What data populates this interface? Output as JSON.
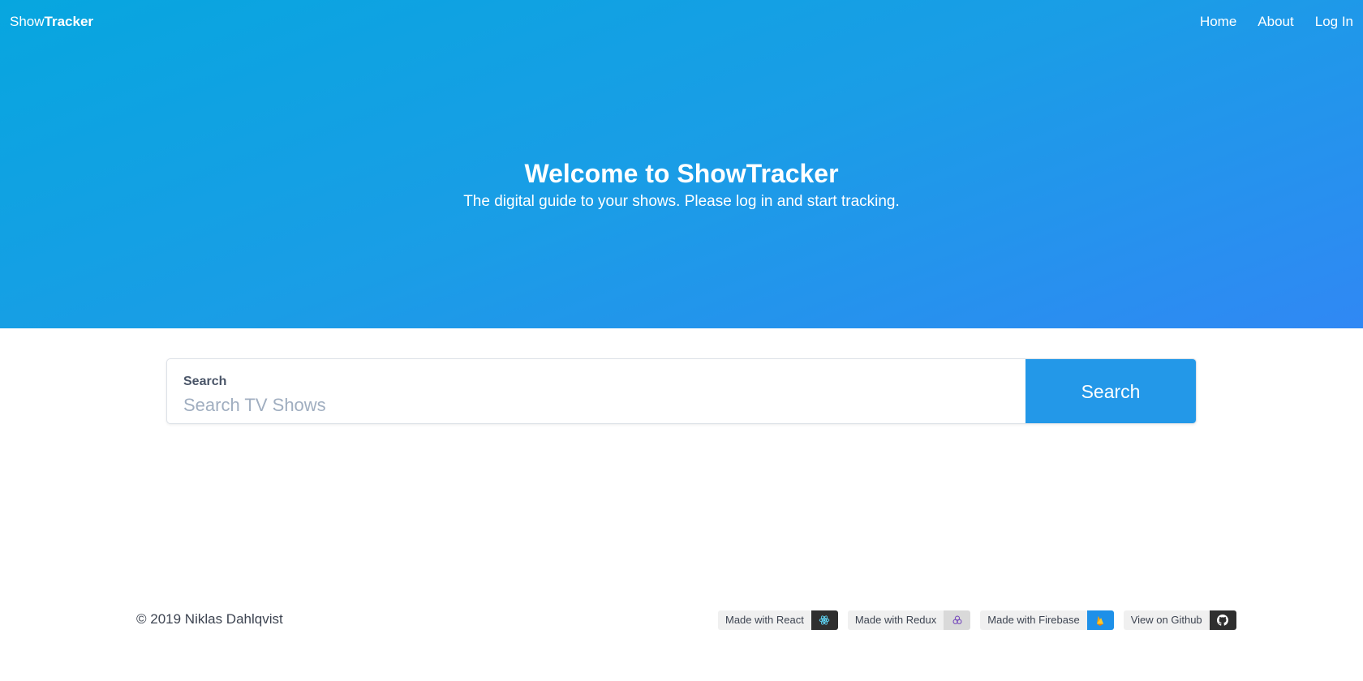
{
  "brand": {
    "part1": "Show",
    "part2": "Tracker"
  },
  "nav": {
    "home": "Home",
    "about": "About",
    "login": "Log In"
  },
  "hero": {
    "title": "Welcome to ShowTracker",
    "subtitle": "The digital guide to your shows. Please log in and start tracking."
  },
  "search": {
    "label": "Search",
    "placeholder": "Search TV Shows",
    "value": "",
    "button": "Search"
  },
  "footer": {
    "copyright": "© 2019 Niklas Dahlqvist",
    "badges": [
      {
        "label": "Made with React",
        "icon": "react-icon",
        "color": "#2f2f2f"
      },
      {
        "label": "Made with Redux",
        "icon": "redux-icon",
        "color": "#d9d9d9"
      },
      {
        "label": "Made with Firebase",
        "icon": "firebase-icon",
        "color": "#1e90e8"
      },
      {
        "label": "View on Github",
        "icon": "github-icon",
        "color": "#2f2f2f"
      }
    ]
  },
  "colors": {
    "hero_start": "#07a6df",
    "hero_end": "#3088f4",
    "accent": "#2398e8"
  }
}
